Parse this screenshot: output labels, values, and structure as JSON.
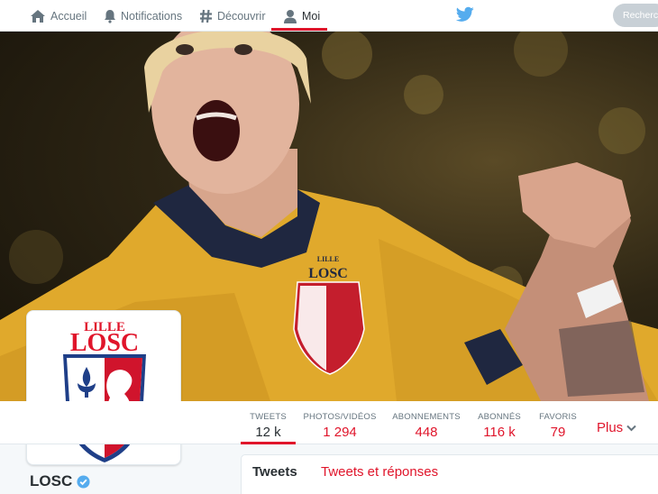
{
  "nav": {
    "items": [
      {
        "label": "Accueil",
        "icon": "home-icon"
      },
      {
        "label": "Notifications",
        "icon": "bell-icon"
      },
      {
        "label": "Découvrir",
        "icon": "hashtag-icon"
      },
      {
        "label": "Moi",
        "icon": "person-icon",
        "active": true
      }
    ],
    "search_placeholder": "Rechercher"
  },
  "profile": {
    "name": "LOSC",
    "verified": true,
    "logo": {
      "top_text": "LILLE",
      "main_text": "LOSC"
    }
  },
  "banner": {
    "jersey_badge": {
      "top_text": "LILLE",
      "main_text": "LOSC"
    }
  },
  "stats": [
    {
      "label": "TWEETS",
      "value": "12 k",
      "active": true
    },
    {
      "label": "PHOTOS/VIDÉOS",
      "value": "1 294"
    },
    {
      "label": "ABONNEMENTS",
      "value": "448"
    },
    {
      "label": "ABONNÉS",
      "value": "116 k"
    },
    {
      "label": "FAVORIS",
      "value": "79"
    }
  ],
  "more_label": "Plus",
  "timeline_tabs": [
    {
      "label": "Tweets",
      "active": true
    },
    {
      "label": "Tweets et réponses"
    }
  ],
  "colors": {
    "accent": "#e0152b",
    "jersey": "#e0a92c",
    "verified": "#55acee",
    "twitter_blue": "#55acee"
  }
}
